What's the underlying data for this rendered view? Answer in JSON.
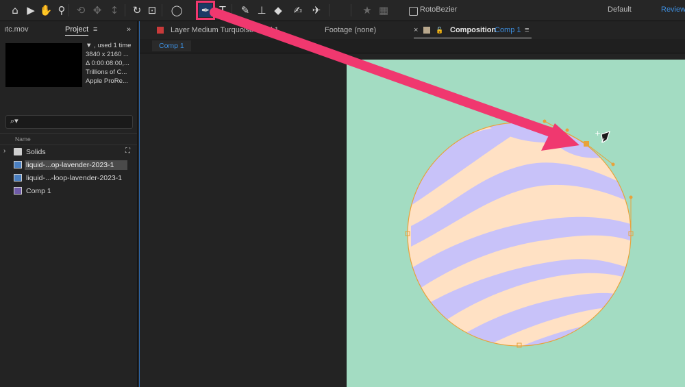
{
  "toolbar": {
    "tools": [
      {
        "name": "home-icon",
        "glyph": "⌂",
        "active": false
      },
      {
        "name": "selection-tool-icon",
        "glyph": "▶",
        "active": false
      },
      {
        "name": "hand-tool-icon",
        "glyph": "✋",
        "active": false
      },
      {
        "name": "zoom-tool-icon",
        "glyph": "⚲",
        "active": false
      },
      {
        "name": "orbit-camera-icon",
        "glyph": "⟲",
        "active": false
      },
      {
        "name": "pan-camera-icon",
        "glyph": "✥",
        "active": false
      },
      {
        "name": "dolly-camera-icon",
        "glyph": "↕",
        "active": false
      },
      {
        "name": "rotation-tool-icon",
        "glyph": "↻",
        "active": false
      },
      {
        "name": "pan-behind-icon",
        "glyph": "⊡",
        "active": false
      },
      {
        "name": "ellipse-tool-icon",
        "glyph": "◯",
        "active": false
      },
      {
        "name": "pen-tool-icon",
        "glyph": "✒",
        "active": true
      },
      {
        "name": "type-tool-icon",
        "glyph": "T",
        "active": false
      },
      {
        "name": "brush-tool-icon",
        "glyph": "✎",
        "active": false
      },
      {
        "name": "clone-stamp-icon",
        "glyph": "⊥",
        "active": false
      },
      {
        "name": "eraser-tool-icon",
        "glyph": "◆",
        "active": false
      },
      {
        "name": "roto-brush-icon",
        "glyph": "✍",
        "active": false
      },
      {
        "name": "puppet-pin-icon",
        "glyph": "✈",
        "active": false
      },
      {
        "name": "star-icon",
        "glyph": "★",
        "active": false
      },
      {
        "name": "snapping-icon",
        "glyph": "▦",
        "active": false
      }
    ],
    "rotobezier_label": "RotoBezier",
    "workspace_default": "Default",
    "workspace_review": "Review"
  },
  "project_panel": {
    "tab_left": "ıtc.mov",
    "tab_project": "Project",
    "menu_glyph": "≡",
    "overflow_glyph": "»",
    "info_lines": [
      "▼ , used 1 time",
      "3840 x 2160 ...",
      "Δ 0:00:08:00,...",
      "Trillions of C...",
      "Apple ProRe..."
    ],
    "search_glyph": "⌕▾",
    "column_name": "Name",
    "items": [
      {
        "label": "Solids",
        "type": "folder",
        "selected": false
      },
      {
        "label": "liquid-...op-lavender-2023-1",
        "type": "footage",
        "selected": true
      },
      {
        "label": "liquid-...-loop-lavender-2023-1",
        "type": "footage",
        "selected": false
      },
      {
        "label": "Comp 1",
        "type": "comp",
        "selected": false
      }
    ]
  },
  "viewer": {
    "tab_layer": "Layer Medium Turquoise Solid 1",
    "tab_footage": "Footage (none)",
    "tab_comp_prefix": "Composition",
    "tab_comp_name": "Comp 1",
    "close_glyph": "×",
    "lock_glyph": "🔓",
    "menu_glyph": "≡",
    "subtab": "Comp 1"
  },
  "colors": {
    "comp_background": "#a3dcc2",
    "stripe_a": "#ffe1c4",
    "stripe_b": "#c8c2f9",
    "mask_path": "#e8a23a",
    "arrow": "#f0386f",
    "layer_swatch": "#c93a3a",
    "comp_swatch": "#b8a78c"
  }
}
